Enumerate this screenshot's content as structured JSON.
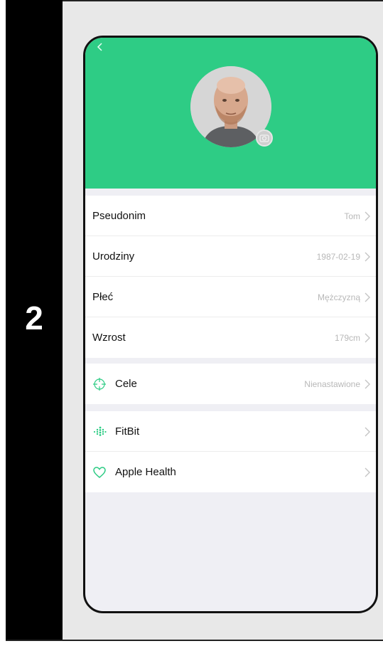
{
  "step": {
    "number": "2"
  },
  "colors": {
    "header": "#2ecc85",
    "icon_accent": "#2ecc85",
    "chevron": "#c4c4c4"
  },
  "profile": {
    "rows": [
      {
        "label": "Pseudonim",
        "value": "Tom"
      },
      {
        "label": "Urodziny",
        "value": "1987-02-19"
      },
      {
        "label": "Płeć",
        "value": "Mężczyzną"
      },
      {
        "label": "Wzrost",
        "value": "179cm"
      }
    ],
    "goals": {
      "label": "Cele",
      "value": "Nienastawione",
      "icon": "target-icon"
    },
    "integrations": [
      {
        "label": "FitBit",
        "icon": "fitbit-icon"
      },
      {
        "label": "Apple Health",
        "icon": "heart-icon"
      }
    ]
  }
}
